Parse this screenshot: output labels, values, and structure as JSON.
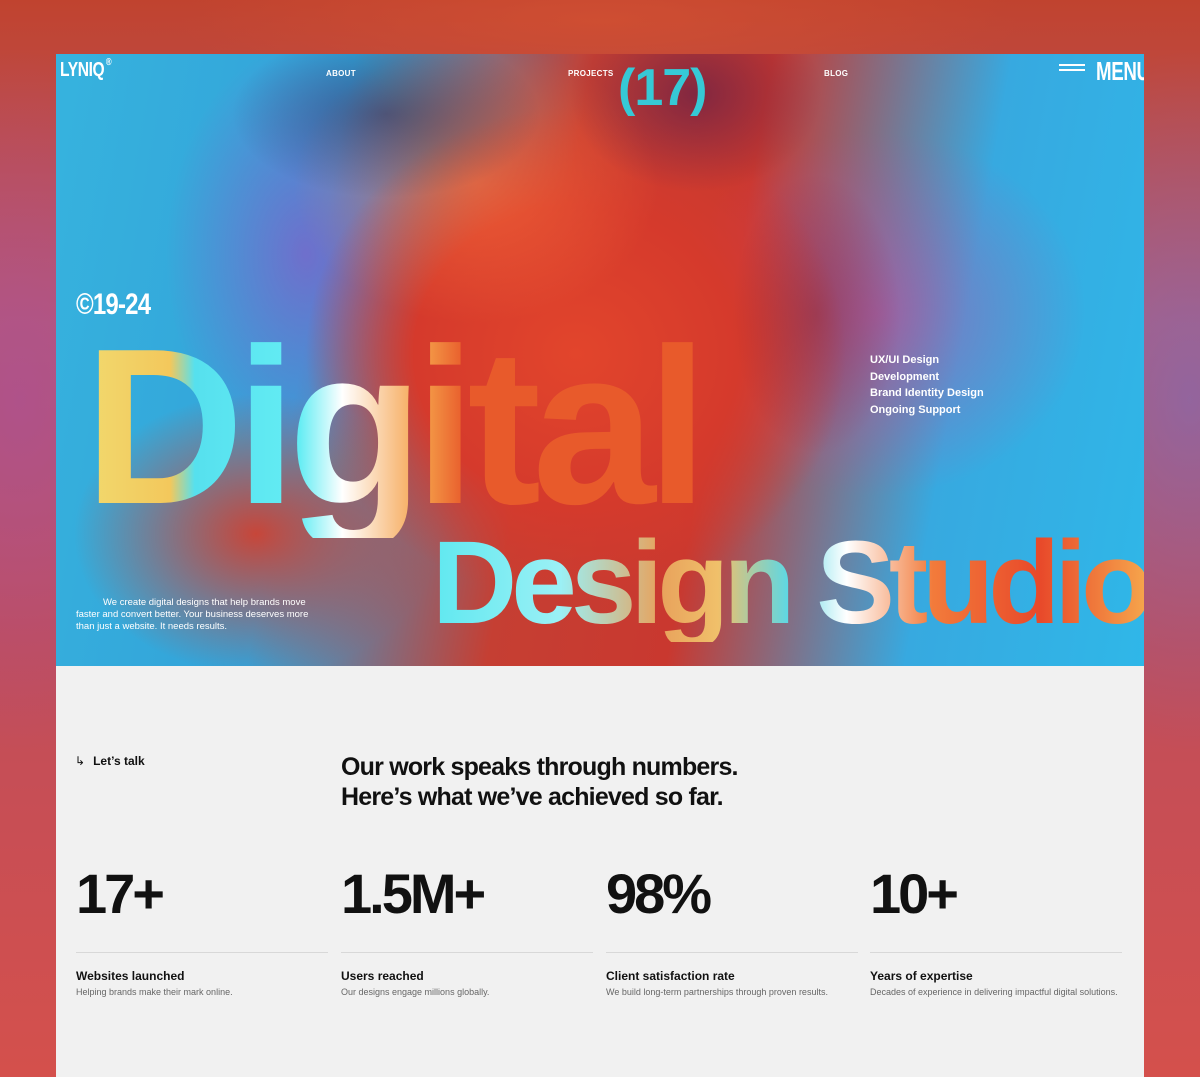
{
  "header": {
    "logo": "LYNIQ",
    "logo_mark": "®",
    "nav": [
      "ABOUT",
      "PROJECTS",
      "BLOG"
    ],
    "projects_count": "(17)",
    "menu_label": "MENU",
    "menu_icon": "hamburger-icon"
  },
  "hero": {
    "copyright": "©19-24",
    "headline_line1": "Digital",
    "headline_line2": "Design Studio",
    "services": [
      "UX/UI Design",
      "Development",
      "Brand Identity Design",
      "Ongoing Support"
    ],
    "tagline": "We create digital designs that help brands move faster and convert better. Your business deserves more than just a website. It needs results."
  },
  "stats_section": {
    "cta_label": "Let’s talk",
    "cta_icon": "arrow-down-right-icon",
    "intro_line1": "Our work speaks through numbers.",
    "intro_line2": "Here’s what we’ve achieved so far.",
    "stats": [
      {
        "value": "17+",
        "label": "Websites launched",
        "desc": "Helping brands make their mark online."
      },
      {
        "value": "1.5M+",
        "label": "Users reached",
        "desc": "Our designs engage millions globally."
      },
      {
        "value": "98%",
        "label": "Client satisfaction rate",
        "desc": "We build long-term partnerships through proven results."
      },
      {
        "value": "10+",
        "label": "Years of expertise",
        "desc": "Decades of experience in delivering impactful digital solutions."
      }
    ]
  }
}
